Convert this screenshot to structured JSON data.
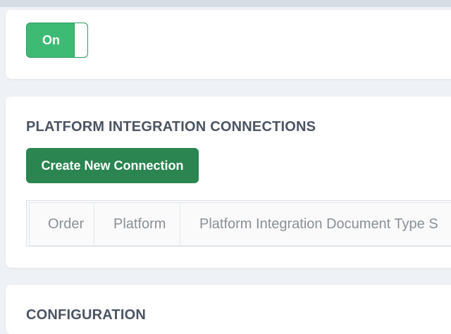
{
  "toggle": {
    "label": "On",
    "state": "on",
    "color": "#3dbb74"
  },
  "integrations": {
    "title": "PLATFORM INTEGRATION CONNECTIONS",
    "create_button": "Create New Connection",
    "button_color": "#2a8550",
    "table": {
      "columns": [
        "Order",
        "Platform",
        "Platform Integration Document Type S"
      ]
    }
  },
  "configuration": {
    "title": "CONFIGURATION"
  }
}
